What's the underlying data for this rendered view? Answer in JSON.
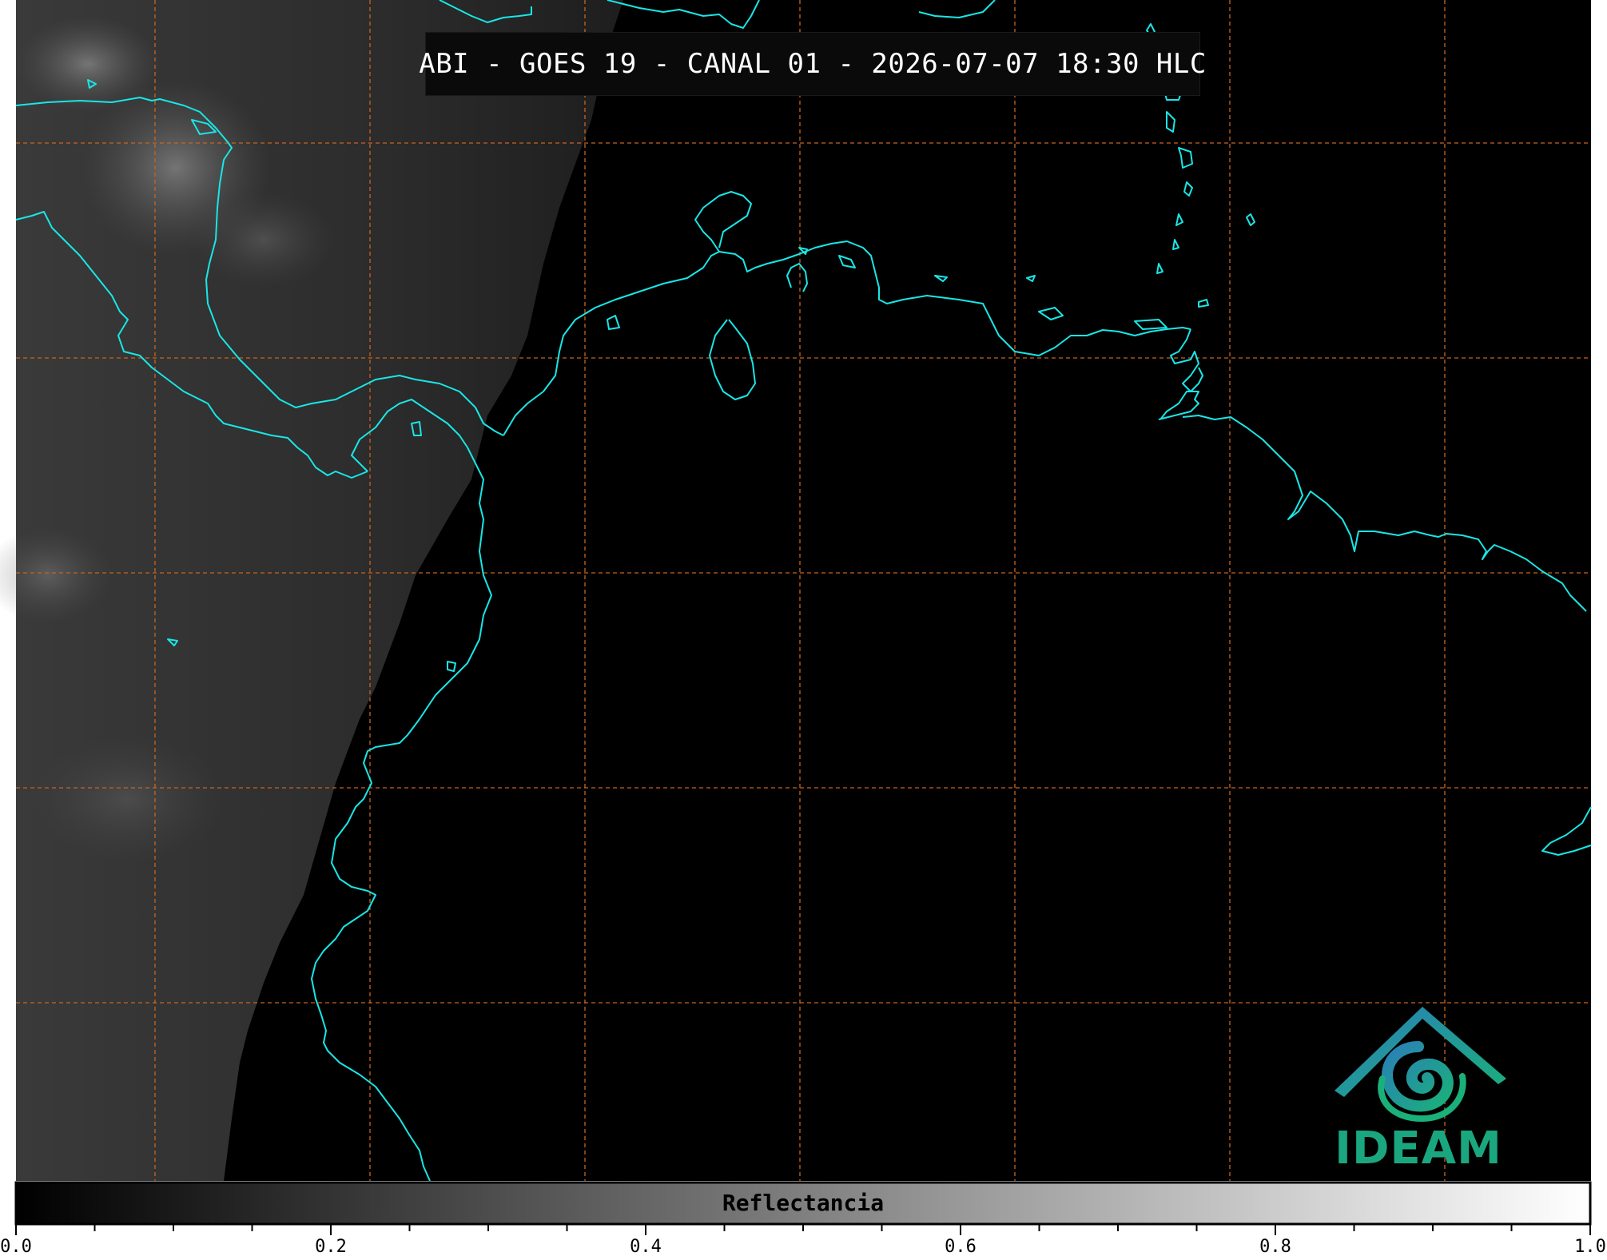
{
  "title": "ABI - GOES 19 - CANAL 01 - 2026-07-07 18:30 HLC",
  "colors": {
    "coastline": "#19e6e6",
    "graticule": "#c8641e",
    "ocean_background": "#000000",
    "cloud_gray_dark": "#1c1c1c",
    "cloud_gray_light": "#6a6a6a",
    "logo_blue": "#2a8fb0",
    "logo_green": "#1aa77f"
  },
  "logo": {
    "text": "IDEAM",
    "icon": "ideam-mountain-swirl-icon"
  },
  "colorbar": {
    "label": "Reflectancia",
    "colormap": "grayscale",
    "range": [
      0.0,
      1.0
    ],
    "tick_labels": [
      "0.0",
      "0.2",
      "0.4",
      "0.6",
      "0.8",
      "1.0"
    ],
    "tick_values": [
      0.0,
      0.2,
      0.4,
      0.6,
      0.8,
      1.0
    ]
  }
}
